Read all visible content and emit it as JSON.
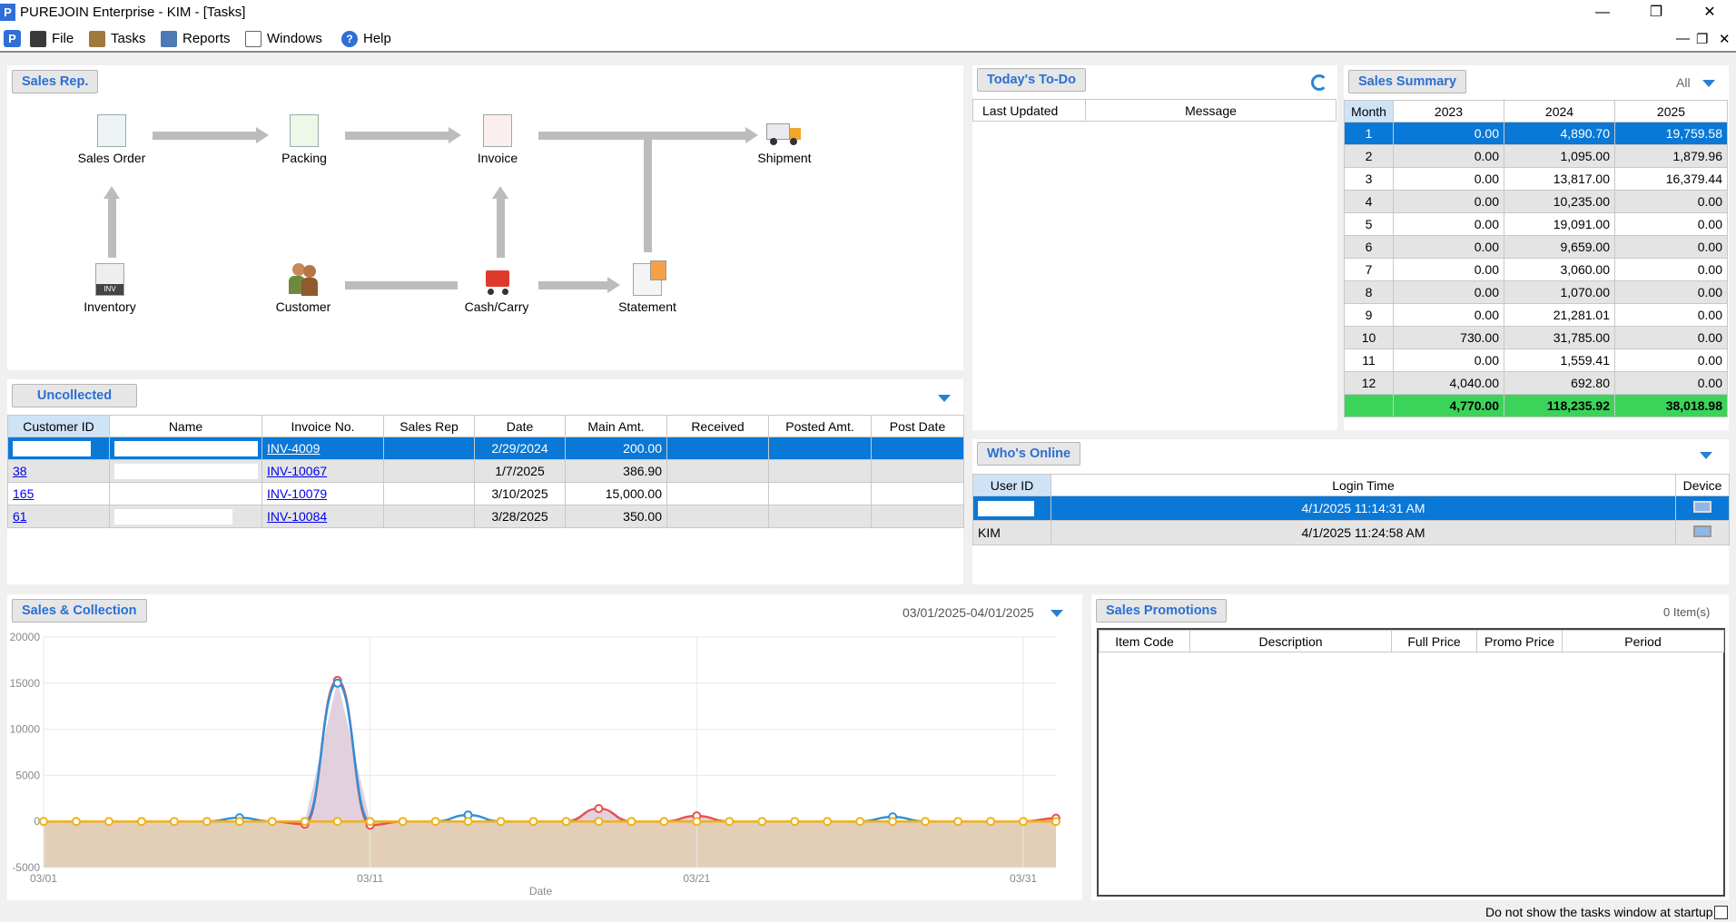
{
  "window": {
    "title": "PUREJOIN Enterprise - KIM - [Tasks]",
    "app_icon": "P"
  },
  "menu": {
    "file": "File",
    "tasks": "Tasks",
    "reports": "Reports",
    "windows": "Windows",
    "help": "Help"
  },
  "sales_rep": {
    "title": "Sales Rep.",
    "nodes": {
      "sales_order": "Sales Order",
      "packing": "Packing",
      "invoice": "Invoice",
      "shipment": "Shipment",
      "inventory": "Inventory",
      "customer": "Customer",
      "cash_carry": "Cash/Carry",
      "statement": "Statement"
    }
  },
  "todo": {
    "title": "Today's To-Do",
    "columns": [
      "Last Updated",
      "Message"
    ]
  },
  "sales_summary": {
    "title": "Sales Summary",
    "filter": "All",
    "columns": [
      "Month",
      "2023",
      "2024",
      "2025"
    ],
    "rows": [
      [
        "1",
        "0.00",
        "4,890.70",
        "19,759.58"
      ],
      [
        "2",
        "0.00",
        "1,095.00",
        "1,879.96"
      ],
      [
        "3",
        "0.00",
        "13,817.00",
        "16,379.44"
      ],
      [
        "4",
        "0.00",
        "10,235.00",
        "0.00"
      ],
      [
        "5",
        "0.00",
        "19,091.00",
        "0.00"
      ],
      [
        "6",
        "0.00",
        "9,659.00",
        "0.00"
      ],
      [
        "7",
        "0.00",
        "3,060.00",
        "0.00"
      ],
      [
        "8",
        "0.00",
        "1,070.00",
        "0.00"
      ],
      [
        "9",
        "0.00",
        "21,281.01",
        "0.00"
      ],
      [
        "10",
        "730.00",
        "31,785.00",
        "0.00"
      ],
      [
        "11",
        "0.00",
        "1,559.41",
        "0.00"
      ],
      [
        "12",
        "4,040.00",
        "692.80",
        "0.00"
      ]
    ],
    "totals": [
      "",
      "4,770.00",
      "118,235.92",
      "38,018.98"
    ]
  },
  "uncollected": {
    "title": "Uncollected",
    "columns": [
      "Customer ID",
      "Name",
      "Invoice No.",
      "Sales Rep",
      "Date",
      "Main Amt.",
      "Received",
      "Posted Amt.",
      "Post Date"
    ],
    "rows": [
      [
        "",
        "",
        "INV-4009",
        "",
        "2/29/2024",
        "200.00",
        "",
        "",
        ""
      ],
      [
        "38",
        "",
        "INV-10067",
        "",
        "1/7/2025",
        "386.90",
        "",
        "",
        ""
      ],
      [
        "165",
        "",
        "INV-10079",
        "",
        "3/10/2025",
        "15,000.00",
        "",
        "",
        ""
      ],
      [
        "61",
        "",
        "INV-10084",
        "",
        "3/28/2025",
        "350.00",
        "",
        "",
        ""
      ]
    ]
  },
  "whos_online": {
    "title": "Who's Online",
    "columns": [
      "User ID",
      "Login Time",
      "Device"
    ],
    "rows": [
      [
        "",
        "4/1/2025 11:14:31 AM",
        "computer-icon"
      ],
      [
        "KIM",
        "4/1/2025 11:24:58 AM",
        "computer-icon"
      ]
    ]
  },
  "sales_collection": {
    "title": "Sales & Collection",
    "date_range": "03/01/2025-04/01/2025"
  },
  "chart_data": {
    "type": "line",
    "xlabel": "Date",
    "ylabel": "",
    "ylim": [
      -5000,
      20000
    ],
    "yticks": [
      20000,
      15000,
      10000,
      5000,
      0,
      -5000
    ],
    "xtick_labels": [
      "03/01",
      "03/11",
      "03/21",
      "03/31"
    ],
    "x": [
      "03/01",
      "03/02",
      "03/03",
      "03/04",
      "03/05",
      "03/06",
      "03/07",
      "03/08",
      "03/09",
      "03/10",
      "03/11",
      "03/12",
      "03/13",
      "03/14",
      "03/15",
      "03/16",
      "03/17",
      "03/18",
      "03/19",
      "03/20",
      "03/21",
      "03/22",
      "03/23",
      "03/24",
      "03/25",
      "03/26",
      "03/27",
      "03/28",
      "03/29",
      "03/30",
      "03/31",
      "04/01"
    ],
    "series": [
      {
        "color": "#e8514f",
        "values": [
          0,
          0,
          0,
          0,
          0,
          0,
          0,
          0,
          -300,
          15300,
          -400,
          0,
          0,
          0,
          0,
          0,
          0,
          1400,
          0,
          0,
          600,
          0,
          0,
          0,
          0,
          0,
          0,
          0,
          0,
          0,
          0,
          350
        ]
      },
      {
        "color": "#2f8fd8",
        "values": [
          0,
          0,
          0,
          0,
          0,
          0,
          400,
          0,
          0,
          15000,
          0,
          0,
          0,
          700,
          0,
          0,
          0,
          0,
          0,
          0,
          0,
          0,
          0,
          0,
          0,
          0,
          500,
          0,
          0,
          0,
          0,
          0
        ]
      },
      {
        "color": "#f0b21a",
        "values": [
          0,
          0,
          0,
          0,
          0,
          0,
          0,
          0,
          0,
          0,
          0,
          0,
          0,
          0,
          0,
          0,
          0,
          0,
          0,
          0,
          0,
          0,
          0,
          0,
          0,
          0,
          0,
          0,
          0,
          0,
          0,
          0
        ]
      }
    ],
    "grid": true
  },
  "promotions": {
    "title": "Sales Promotions",
    "count": "0 Item(s)",
    "columns": [
      "Item Code",
      "Description",
      "Full Price",
      "Promo Price",
      "Period"
    ]
  },
  "footer": {
    "startup_text": "Do not show the tasks window at startup."
  }
}
